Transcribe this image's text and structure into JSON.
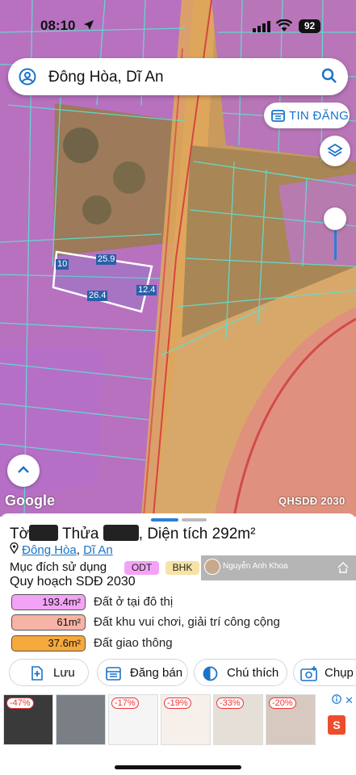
{
  "status_bar": {
    "time": "08:10",
    "battery": "92"
  },
  "search": {
    "query": "Đông Hòa, Dĩ An"
  },
  "map": {
    "tin_dang_label": "TIN ĐĂNG",
    "logo": "Google",
    "layer_name": "QHSDĐ 2030",
    "dimensions": [
      "25.9",
      "10",
      "12.4",
      "26.4"
    ],
    "colors": {
      "residential": "#b968cc",
      "road": "#e2a85a",
      "parcel_line": "#5ee0d0"
    }
  },
  "sheet": {
    "title_prefix": "Tờ",
    "title_mid": "Thửa",
    "title_suffix": ", Diện tích 292m²",
    "ward_link": "Đông Hòa",
    "district_link": "Dĩ An",
    "purpose_label": "Mục đích sử dụng",
    "tags": [
      "ODT",
      "BHK"
    ],
    "promo_name": "Nguyễn Anh Khoa",
    "plan_title": "Quy hoạch SDĐ 2030",
    "legend": [
      {
        "value": "193.4m²",
        "label": "Đất ở tại đô thị",
        "color": "#f3a3f5"
      },
      {
        "value": "61m²",
        "label": "Đất khu vui chơi, giải trí công cộng",
        "color": "#f7b3a5"
      },
      {
        "value": "37.6m²",
        "label": "Đất giao thông",
        "color": "#f6a93c"
      }
    ],
    "actions": [
      {
        "label": "Lưu",
        "icon": "save-plus-icon"
      },
      {
        "label": "Đăng bán",
        "icon": "sell-calendar-icon"
      },
      {
        "label": "Chú thích",
        "icon": "legend-contrast-icon"
      },
      {
        "label": "Chụp",
        "icon": "camera-plus-icon"
      }
    ],
    "ads": [
      {
        "discount": "-47%"
      },
      {
        "discount": ""
      },
      {
        "discount": "-17%"
      },
      {
        "discount": "-19%"
      },
      {
        "discount": "-33%"
      },
      {
        "discount": "-20%"
      }
    ],
    "shopee_logo": "S"
  }
}
